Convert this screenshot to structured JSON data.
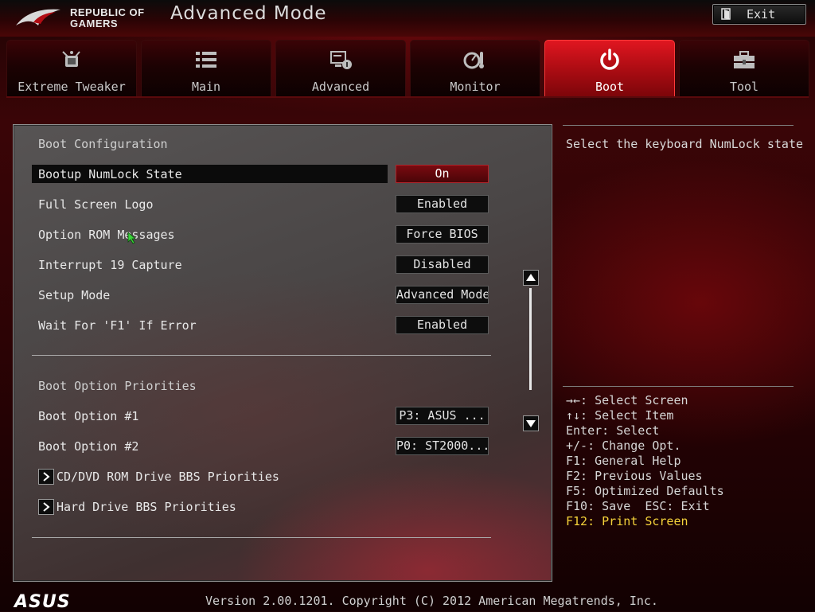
{
  "header": {
    "brand": "REPUBLIC OF GAMERS",
    "title": "Advanced Mode",
    "exit_label": "Exit"
  },
  "tabs": [
    {
      "label": "Extreme Tweaker",
      "icon": "tweaker-icon"
    },
    {
      "label": "Main",
      "icon": "list-icon"
    },
    {
      "label": "Advanced",
      "icon": "advanced-icon"
    },
    {
      "label": "Monitor",
      "icon": "monitor-icon"
    },
    {
      "label": "Boot",
      "icon": "power-icon",
      "active": true
    },
    {
      "label": "Tool",
      "icon": "toolbox-icon"
    }
  ],
  "boot_config": {
    "title": "Boot Configuration",
    "items": [
      {
        "label": "Bootup NumLock State",
        "value": "On",
        "selected": true
      },
      {
        "label": "Full Screen Logo",
        "value": "Enabled"
      },
      {
        "label": "Option ROM Messages",
        "value": "Force BIOS"
      },
      {
        "label": "Interrupt 19 Capture",
        "value": "Disabled"
      },
      {
        "label": "Setup Mode",
        "value": "Advanced Mode"
      },
      {
        "label": "Wait For 'F1' If Error",
        "value": "Enabled"
      }
    ]
  },
  "boot_priorities": {
    "title": "Boot Option Priorities",
    "items": [
      {
        "label": "Boot Option #1",
        "value": "P3: ASUS   ..."
      },
      {
        "label": "Boot Option #2",
        "value": "P0: ST2000..."
      }
    ],
    "submenus": [
      {
        "label": "CD/DVD ROM Drive BBS Priorities"
      },
      {
        "label": "Hard Drive BBS Priorities"
      }
    ]
  },
  "help_text": "Select the keyboard NumLock state",
  "key_legend": [
    "→←: Select Screen",
    "↑↓: Select Item",
    "Enter: Select",
    "+/-: Change Opt.",
    "F1: General Help",
    "F2: Previous Values",
    "F5: Optimized Defaults",
    "F10: Save  ESC: Exit",
    "F12: Print Screen"
  ],
  "footer": {
    "logo": "ASUS",
    "version": "Version 2.00.1201. Copyright (C) 2012 American Megatrends, Inc."
  },
  "colors": {
    "accent_red": "#d3101a",
    "highlight_yellow": "#f4d23a",
    "panel_gray": "#4a4646"
  }
}
